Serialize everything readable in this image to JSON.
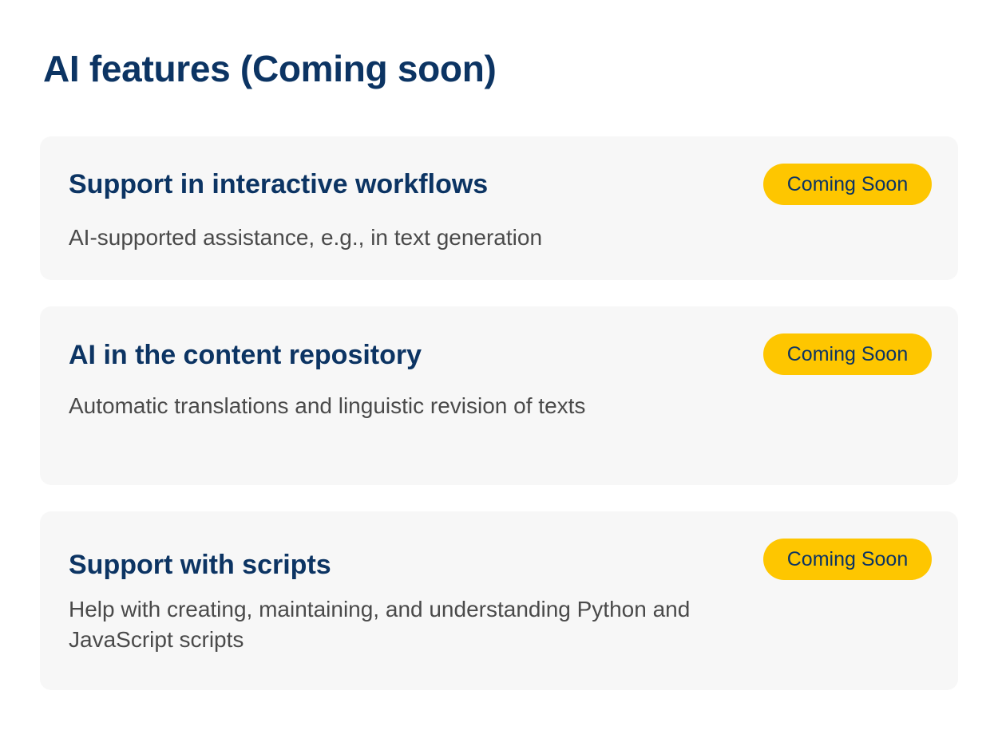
{
  "page": {
    "title": "AI features (Coming soon)"
  },
  "colors": {
    "heading": "#0c3463",
    "description": "#4a4a4a",
    "card_background": "#f7f7f7",
    "badge_background": "#fec600",
    "badge_text": "#0c3463"
  },
  "features": [
    {
      "title": "Support in interactive workflows",
      "description": "AI-supported assistance, e.g., in text generation",
      "badge": "Coming Soon"
    },
    {
      "title": "AI in the content repository",
      "description": "Automatic translations and linguistic revision of texts",
      "badge": "Coming Soon"
    },
    {
      "title": "Support with scripts",
      "description": "Help with creating, maintaining, and understanding Python and JavaScript scripts",
      "badge": "Coming Soon"
    }
  ]
}
